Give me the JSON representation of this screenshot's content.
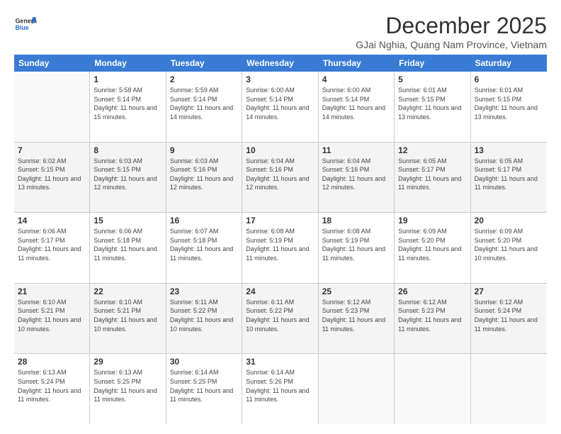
{
  "logo": {
    "line1": "General",
    "line2": "Blue"
  },
  "title": "December 2025",
  "location": "GJai Nghia, Quang Nam Province, Vietnam",
  "header_days": [
    "Sunday",
    "Monday",
    "Tuesday",
    "Wednesday",
    "Thursday",
    "Friday",
    "Saturday"
  ],
  "weeks": [
    [
      {
        "day": "",
        "sunrise": "",
        "sunset": "",
        "daylight": ""
      },
      {
        "day": "1",
        "sunrise": "Sunrise: 5:58 AM",
        "sunset": "Sunset: 5:14 PM",
        "daylight": "Daylight: 11 hours and 15 minutes."
      },
      {
        "day": "2",
        "sunrise": "Sunrise: 5:59 AM",
        "sunset": "Sunset: 5:14 PM",
        "daylight": "Daylight: 11 hours and 14 minutes."
      },
      {
        "day": "3",
        "sunrise": "Sunrise: 6:00 AM",
        "sunset": "Sunset: 5:14 PM",
        "daylight": "Daylight: 11 hours and 14 minutes."
      },
      {
        "day": "4",
        "sunrise": "Sunrise: 6:00 AM",
        "sunset": "Sunset: 5:14 PM",
        "daylight": "Daylight: 11 hours and 14 minutes."
      },
      {
        "day": "5",
        "sunrise": "Sunrise: 6:01 AM",
        "sunset": "Sunset: 5:15 PM",
        "daylight": "Daylight: 11 hours and 13 minutes."
      },
      {
        "day": "6",
        "sunrise": "Sunrise: 6:01 AM",
        "sunset": "Sunset: 5:15 PM",
        "daylight": "Daylight: 11 hours and 13 minutes."
      }
    ],
    [
      {
        "day": "7",
        "sunrise": "Sunrise: 6:02 AM",
        "sunset": "Sunset: 5:15 PM",
        "daylight": "Daylight: 11 hours and 13 minutes."
      },
      {
        "day": "8",
        "sunrise": "Sunrise: 6:03 AM",
        "sunset": "Sunset: 5:15 PM",
        "daylight": "Daylight: 11 hours and 12 minutes."
      },
      {
        "day": "9",
        "sunrise": "Sunrise: 6:03 AM",
        "sunset": "Sunset: 5:16 PM",
        "daylight": "Daylight: 11 hours and 12 minutes."
      },
      {
        "day": "10",
        "sunrise": "Sunrise: 6:04 AM",
        "sunset": "Sunset: 5:16 PM",
        "daylight": "Daylight: 11 hours and 12 minutes."
      },
      {
        "day": "11",
        "sunrise": "Sunrise: 6:04 AM",
        "sunset": "Sunset: 5:16 PM",
        "daylight": "Daylight: 11 hours and 12 minutes."
      },
      {
        "day": "12",
        "sunrise": "Sunrise: 6:05 AM",
        "sunset": "Sunset: 5:17 PM",
        "daylight": "Daylight: 11 hours and 11 minutes."
      },
      {
        "day": "13",
        "sunrise": "Sunrise: 6:05 AM",
        "sunset": "Sunset: 5:17 PM",
        "daylight": "Daylight: 11 hours and 11 minutes."
      }
    ],
    [
      {
        "day": "14",
        "sunrise": "Sunrise: 6:06 AM",
        "sunset": "Sunset: 5:17 PM",
        "daylight": "Daylight: 11 hours and 11 minutes."
      },
      {
        "day": "15",
        "sunrise": "Sunrise: 6:06 AM",
        "sunset": "Sunset: 5:18 PM",
        "daylight": "Daylight: 11 hours and 11 minutes."
      },
      {
        "day": "16",
        "sunrise": "Sunrise: 6:07 AM",
        "sunset": "Sunset: 5:18 PM",
        "daylight": "Daylight: 11 hours and 11 minutes."
      },
      {
        "day": "17",
        "sunrise": "Sunrise: 6:08 AM",
        "sunset": "Sunset: 5:19 PM",
        "daylight": "Daylight: 11 hours and 11 minutes."
      },
      {
        "day": "18",
        "sunrise": "Sunrise: 6:08 AM",
        "sunset": "Sunset: 5:19 PM",
        "daylight": "Daylight: 11 hours and 11 minutes."
      },
      {
        "day": "19",
        "sunrise": "Sunrise: 6:09 AM",
        "sunset": "Sunset: 5:20 PM",
        "daylight": "Daylight: 11 hours and 11 minutes."
      },
      {
        "day": "20",
        "sunrise": "Sunrise: 6:09 AM",
        "sunset": "Sunset: 5:20 PM",
        "daylight": "Daylight: 11 hours and 10 minutes."
      }
    ],
    [
      {
        "day": "21",
        "sunrise": "Sunrise: 6:10 AM",
        "sunset": "Sunset: 5:21 PM",
        "daylight": "Daylight: 11 hours and 10 minutes."
      },
      {
        "day": "22",
        "sunrise": "Sunrise: 6:10 AM",
        "sunset": "Sunset: 5:21 PM",
        "daylight": "Daylight: 11 hours and 10 minutes."
      },
      {
        "day": "23",
        "sunrise": "Sunrise: 6:11 AM",
        "sunset": "Sunset: 5:22 PM",
        "daylight": "Daylight: 11 hours and 10 minutes."
      },
      {
        "day": "24",
        "sunrise": "Sunrise: 6:11 AM",
        "sunset": "Sunset: 5:22 PM",
        "daylight": "Daylight: 11 hours and 10 minutes."
      },
      {
        "day": "25",
        "sunrise": "Sunrise: 6:12 AM",
        "sunset": "Sunset: 5:23 PM",
        "daylight": "Daylight: 11 hours and 11 minutes."
      },
      {
        "day": "26",
        "sunrise": "Sunrise: 6:12 AM",
        "sunset": "Sunset: 5:23 PM",
        "daylight": "Daylight: 11 hours and 11 minutes."
      },
      {
        "day": "27",
        "sunrise": "Sunrise: 6:12 AM",
        "sunset": "Sunset: 5:24 PM",
        "daylight": "Daylight: 11 hours and 11 minutes."
      }
    ],
    [
      {
        "day": "28",
        "sunrise": "Sunrise: 6:13 AM",
        "sunset": "Sunset: 5:24 PM",
        "daylight": "Daylight: 11 hours and 11 minutes."
      },
      {
        "day": "29",
        "sunrise": "Sunrise: 6:13 AM",
        "sunset": "Sunset: 5:25 PM",
        "daylight": "Daylight: 11 hours and 11 minutes."
      },
      {
        "day": "30",
        "sunrise": "Sunrise: 6:14 AM",
        "sunset": "Sunset: 5:25 PM",
        "daylight": "Daylight: 11 hours and 11 minutes."
      },
      {
        "day": "31",
        "sunrise": "Sunrise: 6:14 AM",
        "sunset": "Sunset: 5:26 PM",
        "daylight": "Daylight: 11 hours and 11 minutes."
      },
      {
        "day": "",
        "sunrise": "",
        "sunset": "",
        "daylight": ""
      },
      {
        "day": "",
        "sunrise": "",
        "sunset": "",
        "daylight": ""
      },
      {
        "day": "",
        "sunrise": "",
        "sunset": "",
        "daylight": ""
      }
    ]
  ]
}
